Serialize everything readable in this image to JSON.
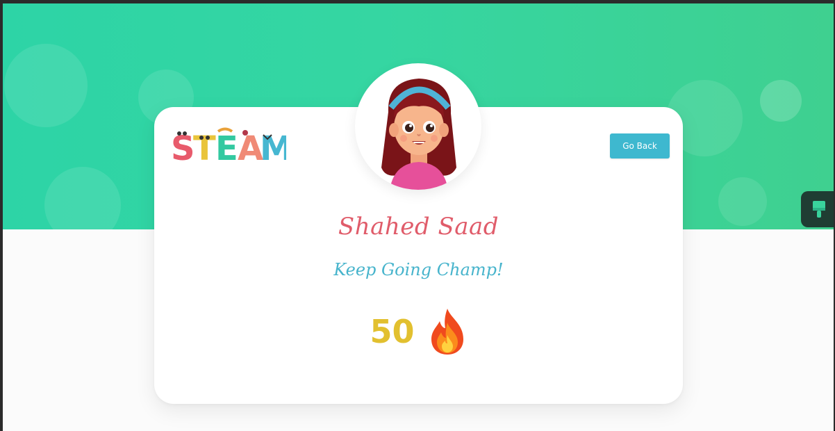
{
  "brand": {
    "logo_text": "STEAM",
    "logo_colors": [
      "#e85b6c",
      "#e9c43a",
      "#33c9a0",
      "#f08a76",
      "#46b7d1"
    ]
  },
  "profile": {
    "name": "Shahed Saad",
    "message": "Keep Going Champ!",
    "streak_count": "50",
    "streak_icon": "fire-icon"
  },
  "actions": {
    "back_label": "Go Back"
  },
  "colors": {
    "hero_green": "#2dd4a6",
    "name_color": "#e05c6a",
    "message_color": "#47b4cc",
    "streak_color": "#e2c02f",
    "button_color": "#3eb8cf"
  },
  "side_tab": {
    "icon": "paint-brush-icon"
  }
}
